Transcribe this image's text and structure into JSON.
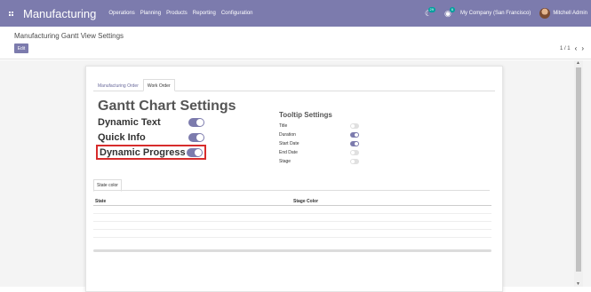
{
  "navbar": {
    "app_title": "Manufacturing",
    "menu": [
      "Operations",
      "Planning",
      "Products",
      "Reporting",
      "Configuration"
    ],
    "chat_badge": "29",
    "activity_badge": "6",
    "company": "My Company (San Francisco)",
    "user": "Mitchell Admin"
  },
  "control_panel": {
    "breadcrumb": "Manufacturing Gantt View Settings",
    "edit_label": "Edit",
    "pager": "1 / 1"
  },
  "tabs": [
    "Manufacturing Order",
    "Work Order"
  ],
  "gantt": {
    "title": "Gantt Chart Settings",
    "settings": [
      {
        "label": "Dynamic Text",
        "value": true
      },
      {
        "label": "Quick Info",
        "value": true
      },
      {
        "label": "Dynamic Progress",
        "value": true
      }
    ]
  },
  "tooltip": {
    "title": "Tooltip Settings",
    "items": [
      {
        "label": "Title",
        "value": false
      },
      {
        "label": "Duration",
        "value": true
      },
      {
        "label": "Start Date",
        "value": true
      },
      {
        "label": "End Date",
        "value": false
      },
      {
        "label": "Stage",
        "value": false
      }
    ]
  },
  "state_section": {
    "tab_label": "State color",
    "columns": [
      "State",
      "Stage Color"
    ]
  },
  "colors": {
    "brand": "#7c7bad",
    "highlight": "#d72c2c"
  }
}
